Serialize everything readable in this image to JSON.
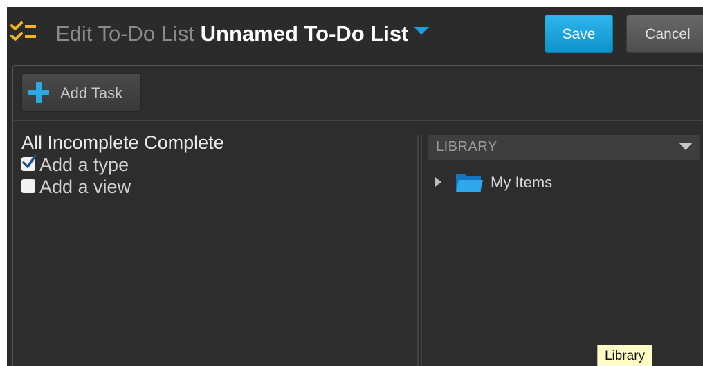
{
  "header": {
    "title_prefix": "Edit To-Do List",
    "list_name": "Unnamed To-Do List",
    "save_label": "Save",
    "cancel_label": "Cancel"
  },
  "toolbar": {
    "add_task_label": "Add Task"
  },
  "filters": {
    "all": "All",
    "incomplete": "Incomplete",
    "complete": "Complete"
  },
  "options": [
    {
      "label": "Add a type",
      "checked": true
    },
    {
      "label": "Add a view",
      "checked": false
    }
  ],
  "library": {
    "header": "LIBRARY",
    "items": [
      {
        "label": "My Items",
        "icon": "folder-icon"
      }
    ],
    "tooltip": "Library"
  },
  "colors": {
    "accent": "#1e9fdb",
    "logo": "#f0b323",
    "background": "#2b2b2b"
  }
}
